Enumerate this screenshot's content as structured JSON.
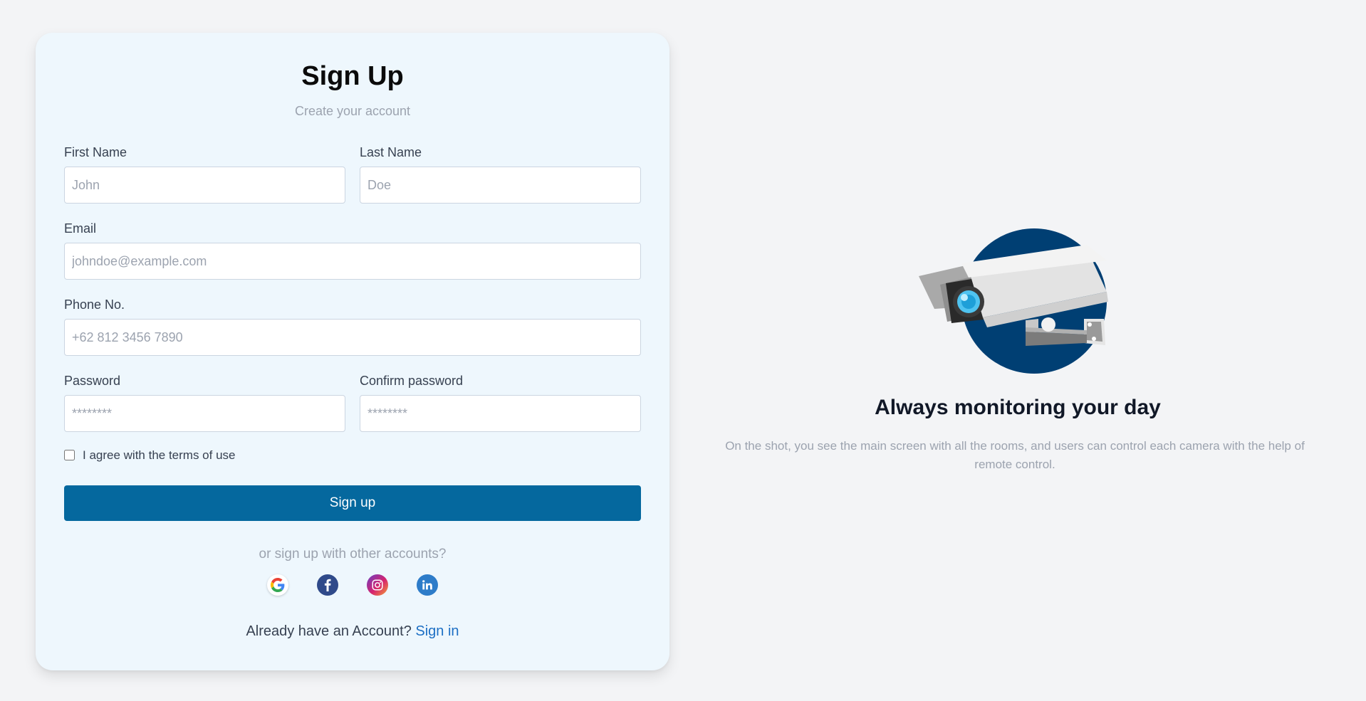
{
  "form": {
    "title": "Sign Up",
    "subtitle": "Create your account",
    "first_name": {
      "label": "First Name",
      "placeholder": "John"
    },
    "last_name": {
      "label": "Last Name",
      "placeholder": "Doe"
    },
    "email": {
      "label": "Email",
      "placeholder": "johndoe@example.com"
    },
    "phone": {
      "label": "Phone No.",
      "placeholder": "+62 812 3456 7890"
    },
    "password": {
      "label": "Password",
      "placeholder": "********"
    },
    "confirm_password": {
      "label": "Confirm password",
      "placeholder": "********"
    },
    "terms_label": "I agree with the terms of use",
    "terms_checked": false,
    "submit_label": "Sign up",
    "other_accounts_text": "or sign up with other accounts?",
    "socials": [
      "google-icon",
      "facebook-icon",
      "instagram-icon",
      "linkedin-icon"
    ],
    "already_text": "Already have an Account?",
    "signin_label": "Sign in"
  },
  "promo": {
    "title": "Always monitoring your day",
    "text": "On the shot, you see the main screen with all the rooms, and users can control each camera with the help of remote control."
  },
  "colors": {
    "page_bg": "#f3f4f6",
    "card_bg": "#eef7fd",
    "primary": "#05689e",
    "link": "#1d6fc4",
    "illustration_circle": "#003f73"
  }
}
